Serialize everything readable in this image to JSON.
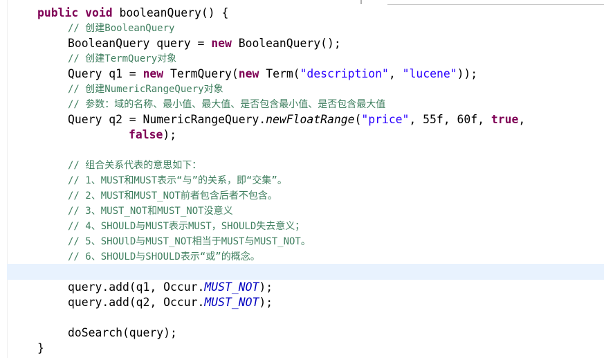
{
  "editor": {
    "lines": [
      {
        "indent": 0,
        "tokens": [
          {
            "t": "public",
            "c": "kw"
          },
          {
            "t": " "
          },
          {
            "t": "void",
            "c": "kw"
          },
          {
            "t": " booleanQuery() {"
          }
        ]
      },
      {
        "indent": 1,
        "comment": true,
        "tokens": [
          {
            "t": "// 创建BooleanQuery",
            "c": "cm"
          }
        ]
      },
      {
        "indent": 1,
        "tokens": [
          {
            "t": "BooleanQuery query = "
          },
          {
            "t": "new",
            "c": "kw"
          },
          {
            "t": " BooleanQuery();"
          }
        ]
      },
      {
        "indent": 1,
        "comment": true,
        "tokens": [
          {
            "t": "// 创建TermQuery对象",
            "c": "cm"
          }
        ]
      },
      {
        "indent": 1,
        "tokens": [
          {
            "t": "Query q1 = "
          },
          {
            "t": "new",
            "c": "kw"
          },
          {
            "t": " TermQuery("
          },
          {
            "t": "new",
            "c": "kw"
          },
          {
            "t": " Term("
          },
          {
            "t": "\"description\"",
            "c": "str"
          },
          {
            "t": ", "
          },
          {
            "t": "\"lucene\"",
            "c": "str"
          },
          {
            "t": "));"
          }
        ]
      },
      {
        "indent": 1,
        "comment": true,
        "tokens": [
          {
            "t": "// 创建NumericRangeQuery对象",
            "c": "cm"
          }
        ]
      },
      {
        "indent": 1,
        "comment": true,
        "tokens": [
          {
            "t": "// 参数：域的名称、最小值、最大值、是否包含最小值、是否包含最大值",
            "c": "cm"
          }
        ]
      },
      {
        "indent": 1,
        "tokens": [
          {
            "t": "Query q2 = NumericRangeQuery."
          },
          {
            "t": "newFloatRange",
            "c": "it"
          },
          {
            "t": "("
          },
          {
            "t": "\"price\"",
            "c": "str"
          },
          {
            "t": ", 55f, 60f, "
          },
          {
            "t": "true",
            "c": "kw"
          },
          {
            "t": ","
          }
        ]
      },
      {
        "indent": 2,
        "tokens": [
          {
            "t": "false",
            "c": "kw"
          },
          {
            "t": ");"
          }
        ]
      },
      {
        "indent": 0,
        "tokens": []
      },
      {
        "indent": 1,
        "comment": true,
        "tokens": [
          {
            "t": "// 组合关系代表的意思如下：",
            "c": "cm"
          }
        ]
      },
      {
        "indent": 1,
        "comment": true,
        "tokens": [
          {
            "t": "// 1、MUST和MUST表示“与”的关系，即“交集”。",
            "c": "cm"
          }
        ]
      },
      {
        "indent": 1,
        "comment": true,
        "tokens": [
          {
            "t": "// 2、MUST和MUST_NOT前者包含后者不包含。",
            "c": "cm"
          }
        ]
      },
      {
        "indent": 1,
        "comment": true,
        "tokens": [
          {
            "t": "// 3、MUST_NOT和MUST_NOT没意义",
            "c": "cm"
          }
        ]
      },
      {
        "indent": 1,
        "comment": true,
        "tokens": [
          {
            "t": "// 4、SHOULD与MUST表示MUST，SHOULD失去意义；",
            "c": "cm"
          }
        ]
      },
      {
        "indent": 1,
        "comment": true,
        "tokens": [
          {
            "t": "// 5、SHOUlD与MUST_NOT相当于MUST与MUST_NOT。",
            "c": "cm"
          }
        ]
      },
      {
        "indent": 1,
        "comment": true,
        "tokens": [
          {
            "t": "// 6、SHOULD与SHOULD表示“或”的概念。",
            "c": "cm"
          }
        ]
      },
      {
        "indent": 0,
        "tokens": []
      },
      {
        "indent": 1,
        "tokens": [
          {
            "t": "query.add(q1, Occur."
          },
          {
            "t": "MUST_NOT",
            "c": "sf"
          },
          {
            "t": ");"
          }
        ]
      },
      {
        "indent": 1,
        "tokens": [
          {
            "t": "query.add(q2, Occur."
          },
          {
            "t": "MUST_NOT",
            "c": "sf"
          },
          {
            "t": ");"
          }
        ]
      },
      {
        "indent": 0,
        "tokens": []
      },
      {
        "indent": 1,
        "tokens": [
          {
            "t": "doSearch(query);"
          }
        ]
      },
      {
        "indent": 0,
        "tokens": [
          {
            "t": "}"
          }
        ]
      }
    ]
  }
}
